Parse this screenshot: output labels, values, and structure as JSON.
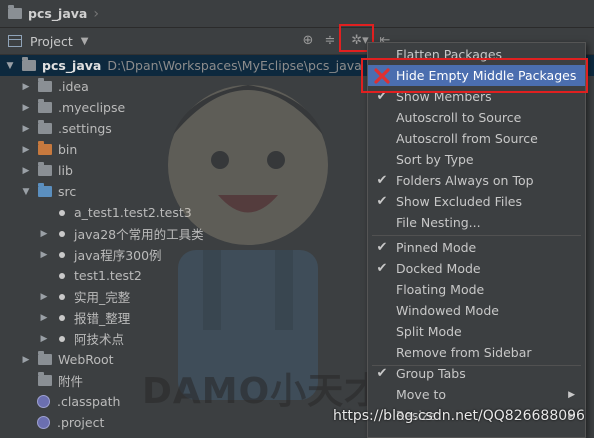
{
  "breadcrumb": {
    "project": "pcs_java"
  },
  "toolbar": {
    "project_label": "Project",
    "icons": [
      "target-icon",
      "collapse-icon",
      "gear-icon",
      "hide-icon"
    ]
  },
  "tree": {
    "root": {
      "name": "pcs_java",
      "path": "D:\\Dpan\\Workspaces\\MyEclipse\\pcs_java"
    },
    "items": [
      {
        "label": "idea",
        "prefix": "."
      },
      {
        "label": ".myeclipse"
      },
      {
        "label": ".settings"
      },
      {
        "label": "bin"
      },
      {
        "label": "lib"
      },
      {
        "label": "src"
      },
      {
        "label": "a_test1.test2.test3"
      },
      {
        "label": "java28个常用的工具类"
      },
      {
        "label": "java程序300例"
      },
      {
        "label": "test1.test2"
      },
      {
        "label": "实用_完整"
      },
      {
        "label": "报错_整理"
      },
      {
        "label": "阿技术点"
      },
      {
        "label": "WebRoot"
      },
      {
        "label": "附件"
      },
      {
        "label": ".classpath"
      },
      {
        "label": ".project"
      }
    ]
  },
  "menu": {
    "items": [
      {
        "label": "Flatten Packages",
        "checked": false
      },
      {
        "label": "Hide Empty Middle Packages",
        "checked": false,
        "active": true
      },
      {
        "label": "Show Members",
        "checked": true
      },
      {
        "label": "Autoscroll to Source",
        "checked": false
      },
      {
        "label": "Autoscroll from Source",
        "checked": false
      },
      {
        "label": "Sort by Type",
        "checked": false
      },
      {
        "label": "Folders Always on Top",
        "checked": true
      },
      {
        "label": "Show Excluded Files",
        "checked": true
      },
      {
        "label": "File Nesting...",
        "checked": false
      },
      {
        "label": "Pinned Mode",
        "checked": true
      },
      {
        "label": "Docked Mode",
        "checked": true
      },
      {
        "label": "Floating Mode",
        "checked": false
      },
      {
        "label": "Windowed Mode",
        "checked": false
      },
      {
        "label": "Split Mode",
        "checked": false
      },
      {
        "label": "Remove from Sidebar",
        "checked": false
      },
      {
        "label": "Group Tabs",
        "checked": true
      },
      {
        "label": "Move to",
        "checked": false
      },
      {
        "label": "Resize",
        "checked": false
      }
    ]
  },
  "watermark": {
    "text": "DAMO小天才",
    "csdn": "https://blog.csdn.net/QQ826688096"
  },
  "colors": {
    "selection": "#4b6eaf",
    "highlight_box": "#e02020",
    "background": "#3c3f41"
  }
}
